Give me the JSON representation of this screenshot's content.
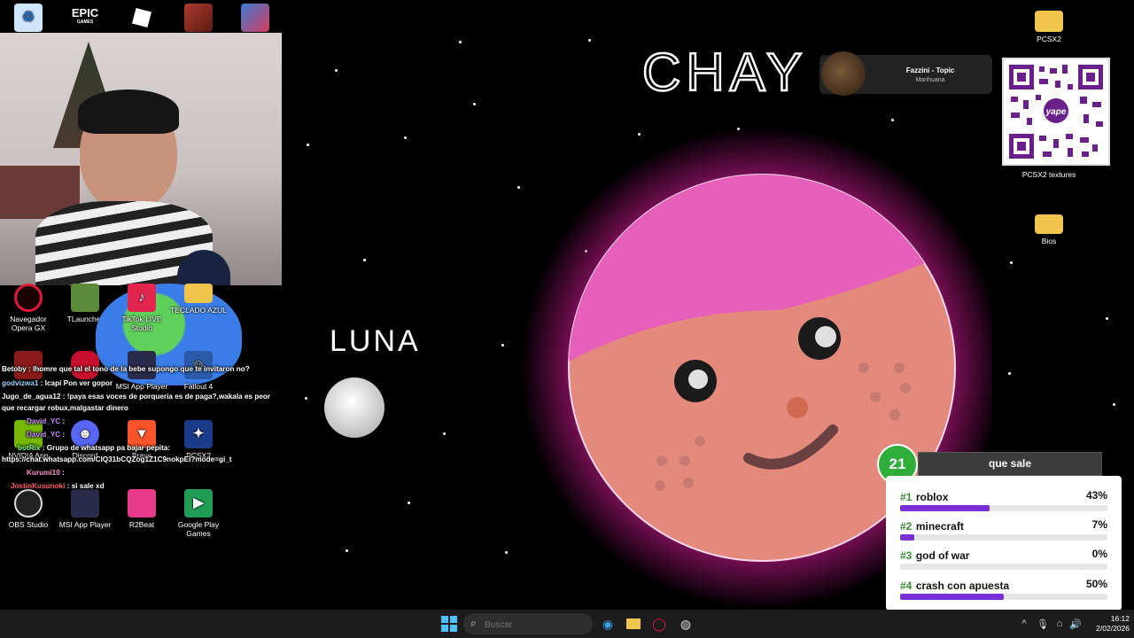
{
  "desktop": {
    "top_icons": [
      {
        "label": "",
        "icon": "recycle-bin-icon"
      },
      {
        "label": "EPIC",
        "sublabel": "GAMES",
        "icon": "epic-games-icon"
      },
      {
        "label": "",
        "icon": "roblox-icon"
      },
      {
        "label": "",
        "icon": "game-shortcut-icon"
      },
      {
        "label": "",
        "icon": "game-shortcut-icon"
      }
    ],
    "right_icons": [
      {
        "label": "PCSX2",
        "icon": "folder-icon"
      },
      {
        "label": "PCSX2 textures",
        "icon": "folder-icon"
      },
      {
        "label": "Bios",
        "icon": "folder-icon"
      }
    ],
    "left_icons_row1": [
      {
        "label": "Navegador Opera GX",
        "icon": "opera-gx-icon"
      },
      {
        "label": "TLauncher",
        "icon": "tlauncher-icon"
      },
      {
        "label": "TikTok LIVE Studio",
        "icon": "tiktok-icon"
      },
      {
        "label": "TECLADO AZUL",
        "icon": "folder-icon"
      }
    ],
    "left_icons_row2": [
      {
        "label": "",
        "icon": "game-shortcut-icon"
      },
      {
        "label": "",
        "icon": "among-us-icon"
      },
      {
        "label": "MSI App Player",
        "icon": "msi-app-player-icon"
      },
      {
        "label": "Fallout 4",
        "icon": "fallout-icon"
      }
    ],
    "left_icons_row3": [
      {
        "label": "NVIDIA App",
        "icon": "nvidia-icon"
      },
      {
        "label": "Discord",
        "icon": "discord-icon"
      },
      {
        "label": "Brave",
        "icon": "brave-icon"
      },
      {
        "label": "PCSX2",
        "icon": "pcsx2-icon"
      }
    ],
    "left_icons_row4": [
      {
        "label": "OBS Studio",
        "icon": "obs-icon"
      },
      {
        "label": "MSI App Player",
        "icon": "msi-app-player-icon"
      },
      {
        "label": "R2Beat",
        "icon": "r2beat-icon"
      },
      {
        "label": "Google Play Games",
        "icon": "google-play-games-icon"
      }
    ]
  },
  "canvas": {
    "title_text": "CHAY",
    "moon_label": "LUNA"
  },
  "now_playing": {
    "title": "Fazzini - Topic",
    "subtitle": "Marihuana"
  },
  "qr": {
    "brand": "yape"
  },
  "chat": [
    {
      "user": "Betoby",
      "user_color": "#ffffff",
      "text": " : lhomre que tal el tono de la bebe supongo que te invitaron no?"
    },
    {
      "user": "godvizwa1",
      "user_color": "#9fd3ff",
      "text": " : lcapi Pon ver gopor"
    },
    {
      "user": "Jugo_de_agua12",
      "user_color": "#ffffff",
      "text": " : !paya esas voces de porqueria es de paga?,wakala es peor"
    },
    {
      "user": "",
      "user_color": "#ffffff",
      "text": "que recargar robux,malgastar dinero"
    },
    {
      "user": "David_YC",
      "user_color": "#c58cff",
      "text": " :"
    },
    {
      "user": "David_YC",
      "user_color": "#c58cff",
      "text": " :"
    },
    {
      "user": "botRix",
      "user_color": "#7fff7f",
      "text": " : Grupo de whatsapp pa bajar pepita:"
    },
    {
      "user": "",
      "user_color": "#ffffff",
      "text": "https://chat.whatsapp.com/CIQ31bCQZog1Z1C9nokpEI?mode=gi_t"
    },
    {
      "user": "Kurumi10",
      "user_color": "#ff8fc8",
      "text": " :"
    },
    {
      "user": "JostinKusunoki",
      "user_color": "#ff5a5a",
      "text": " : si sale xd"
    }
  ],
  "poll": {
    "count": "21",
    "title": "que sale",
    "options": [
      {
        "rank": "#1",
        "name": "roblox",
        "pct": "43%",
        "value": 0.43
      },
      {
        "rank": "#2",
        "name": "minecraft",
        "pct": "7%",
        "value": 0.07
      },
      {
        "rank": "#3",
        "name": "god of war",
        "pct": "0%",
        "value": 0.0
      },
      {
        "rank": "#4",
        "name": "crash con apuesta",
        "pct": "50%",
        "value": 0.5
      }
    ]
  },
  "taskbar": {
    "search_placeholder": "Buscar",
    "time": "16:12",
    "date": "2/02/2026"
  },
  "colors": {
    "planet_body": "#e48a7c",
    "planet_cap": "#e65fb8",
    "planet_glow": "#c2188a",
    "poll_accent": "#7b2fd6",
    "poll_badge": "#2fae3a"
  }
}
